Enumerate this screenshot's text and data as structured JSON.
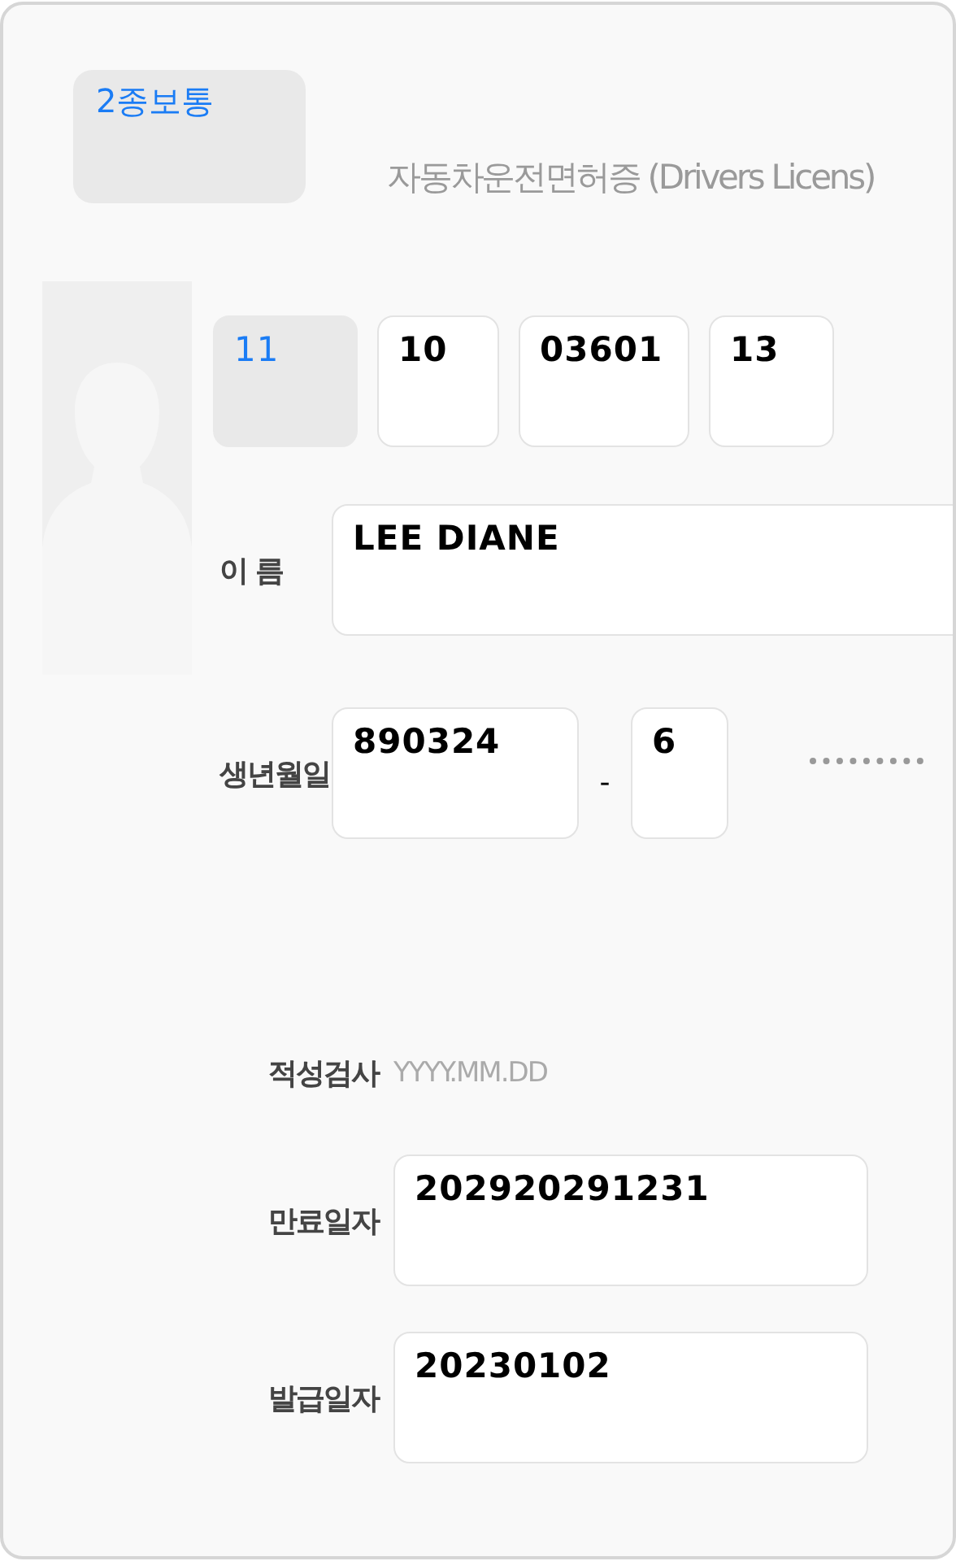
{
  "license_type": {
    "text": "2종보통"
  },
  "title": "자동차운전면허증 (Drivers Licens)",
  "number_fields": [
    {
      "value": "11",
      "kind": "locked"
    },
    {
      "value": "10",
      "kind": "input"
    },
    {
      "value": "03601",
      "kind": "input"
    },
    {
      "value": "13",
      "kind": "input"
    }
  ],
  "name": {
    "label": "이름",
    "value": "LEE DIANE"
  },
  "birth": {
    "label": "생년월일",
    "first": "890324",
    "separator": "-",
    "second": "6"
  },
  "aptitude_test": {
    "label": "적성검사",
    "placeholder": "YYYY.MM.DD"
  },
  "dates": [
    {
      "label": "만료일자",
      "value": "202920291231"
    },
    {
      "label": "발급일자",
      "value": "20230102"
    }
  ]
}
